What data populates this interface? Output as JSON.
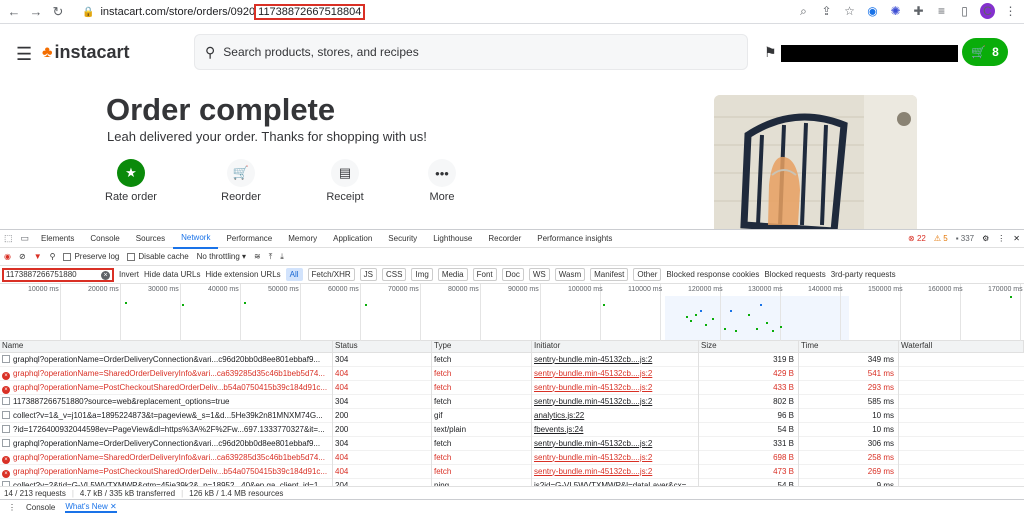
{
  "browser": {
    "url_prefix": "instacart.com/store/orders/0920",
    "url_highlight": "1173887266751880",
    "url_suffix": "4",
    "avatar_letter": "C"
  },
  "header": {
    "logo_text": "instacart",
    "search_placeholder": "Search products, stores, and recipes",
    "cart_count": "8"
  },
  "order": {
    "title": "Order complete",
    "subtitle": "Leah delivered your order. Thanks for shopping with us!",
    "actions": [
      {
        "label": "Rate order"
      },
      {
        "label": "Reorder"
      },
      {
        "label": "Receipt"
      },
      {
        "label": "More"
      }
    ]
  },
  "devtools": {
    "tabs": [
      "Elements",
      "Console",
      "Sources",
      "Network",
      "Performance",
      "Memory",
      "Application",
      "Security",
      "Lighthouse",
      "Recorder",
      "Performance insights"
    ],
    "active_tab": "Network",
    "errors": "22",
    "warnings": "5",
    "messages": "337",
    "toolbar": {
      "preserve_log": "Preserve log",
      "disable_cache": "Disable cache",
      "throttling": "No throttling"
    },
    "filter": {
      "value": "1173887266751880",
      "invert": "Invert",
      "hide_data_urls": "Hide data URLs",
      "hide_extension_urls": "Hide extension URLs",
      "types": [
        "All",
        "Fetch/XHR",
        "JS",
        "CSS",
        "Img",
        "Media",
        "Font",
        "Doc",
        "WS",
        "Wasm",
        "Manifest",
        "Other"
      ],
      "blocked_cookies": "Blocked response cookies",
      "blocked_requests": "Blocked requests",
      "third_party": "3rd-party requests"
    },
    "ticks": [
      "10000 ms",
      "20000 ms",
      "30000 ms",
      "40000 ms",
      "50000 ms",
      "60000 ms",
      "70000 ms",
      "80000 ms",
      "90000 ms",
      "100000 ms",
      "110000 ms",
      "120000 ms",
      "130000 ms",
      "140000 ms",
      "150000 ms",
      "160000 ms",
      "170000 ms"
    ],
    "columns": [
      "Name",
      "Status",
      "Type",
      "Initiator",
      "Size",
      "Time",
      "Waterfall"
    ],
    "rows": [
      {
        "name": "graphql?operationName=OrderDeliveryConnection&vari...c96d20bb0d8ee801ebbaf9...",
        "status": "304",
        "type": "fetch",
        "initiator": "sentry-bundle.min-45132cb....js:2",
        "size": "319 B",
        "time": "349 ms",
        "err": false
      },
      {
        "name": "graphql?operationName=SharedOrderDeliveryInfo&vari...ca639285d35c46b1beb5d74...",
        "status": "404",
        "type": "fetch",
        "initiator": "sentry-bundle.min-45132cb....js:2",
        "size": "429 B",
        "time": "541 ms",
        "err": true
      },
      {
        "name": "graphql?operationName=PostCheckoutSharedOrderDeliv...b54a0750415b39c184d91c...",
        "status": "404",
        "type": "fetch",
        "initiator": "sentry-bundle.min-45132cb....js:2",
        "size": "433 B",
        "time": "293 ms",
        "err": true
      },
      {
        "name": "1173887266751880?source=web&replacement_options=true",
        "status": "304",
        "type": "fetch",
        "initiator": "sentry-bundle.min-45132cb....js:2",
        "size": "802 B",
        "time": "585 ms",
        "err": false
      },
      {
        "name": "collect?v=1&_v=j101&a=1895224873&t=pageview&_s=1&d...5He39k2n81MNXM74G...",
        "status": "200",
        "type": "gif",
        "initiator": "analytics.js:22",
        "size": "96 B",
        "time": "10 ms",
        "err": false
      },
      {
        "name": "?id=1726400932044598ev=PageView&dl=https%3A%2F%2Fw...697.1333770327&it=...",
        "status": "200",
        "type": "text/plain",
        "initiator": "fbevents.js:24",
        "size": "54 B",
        "time": "10 ms",
        "err": false
      },
      {
        "name": "graphql?operationName=OrderDeliveryConnection&vari...c96d20bb0d8ee801ebbaf9...",
        "status": "304",
        "type": "fetch",
        "initiator": "sentry-bundle.min-45132cb....js:2",
        "size": "331 B",
        "time": "306 ms",
        "err": false
      },
      {
        "name": "graphql?operationName=SharedOrderDeliveryInfo&vari...ca639285d35c46b1beb5d74...",
        "status": "404",
        "type": "fetch",
        "initiator": "sentry-bundle.min-45132cb....js:2",
        "size": "698 B",
        "time": "258 ms",
        "err": true
      },
      {
        "name": "graphql?operationName=PostCheckoutSharedOrderDeliv...b54a0750415b39c184d91c...",
        "status": "404",
        "type": "fetch",
        "initiator": "sentry-bundle.min-45132cb....js:2",
        "size": "473 B",
        "time": "269 ms",
        "err": true
      },
      {
        "name": "collect?v=2&tid=G-VL5WVTXMWP&gtm=45je39k2&_p=18952...40&ep.ga_client_id=1...",
        "status": "204",
        "type": "ping",
        "initiator": "js?id=G-VL5WVTXMWP&l=dataLayer&cx=...",
        "size": "54 B",
        "time": "9 ms",
        "err": false
      }
    ],
    "status_bar": {
      "requests": "14 / 213 requests",
      "transferred": "4.7 kB / 335 kB transferred",
      "resources": "126 kB / 1.4 MB resources"
    },
    "drawer_tabs": [
      "Console",
      "What's New"
    ]
  }
}
